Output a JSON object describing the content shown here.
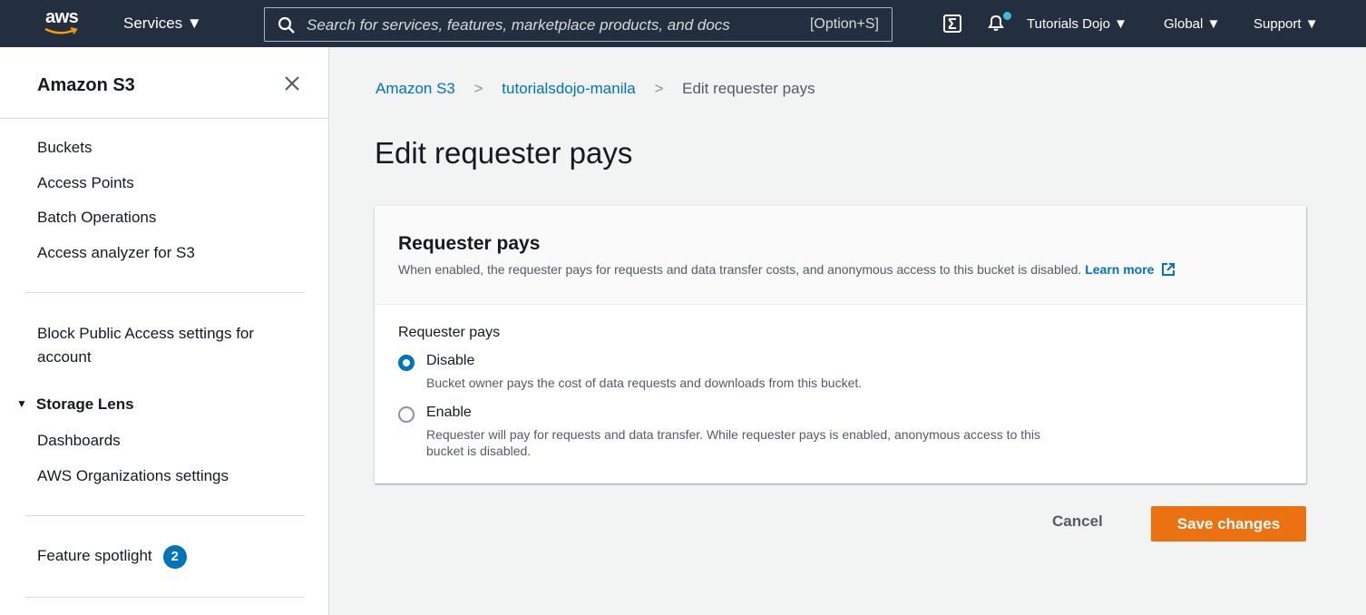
{
  "topnav": {
    "logo_text": "aws",
    "services_label": "Services ▼",
    "search_placeholder": "Search for services, features, marketplace products, and docs",
    "search_shortcut": "[Option+S]",
    "account_label": "Tutorials Dojo ▼",
    "region_label": "Global ▼",
    "support_label": "Support ▼",
    "notification_dot_color": "#44b9d6"
  },
  "sidebar": {
    "title": "Amazon S3",
    "items_group1": [
      "Buckets",
      "Access Points",
      "Batch Operations",
      "Access analyzer for S3"
    ],
    "block_public_access_line1": "Block Public Access settings for",
    "block_public_access_line2": "account",
    "storage_lens": {
      "label": "Storage Lens",
      "expanded": true,
      "items": [
        "Dashboards",
        "AWS Organizations settings"
      ]
    },
    "feature_spotlight": {
      "label": "Feature spotlight",
      "badge": "2"
    }
  },
  "breadcrumb": {
    "items": [
      "Amazon S3",
      "tutorialsdojo-manila",
      "Edit requester pays"
    ]
  },
  "page": {
    "title": "Edit requester pays"
  },
  "card": {
    "title": "Requester pays",
    "description": "When enabled, the requester pays for requests and data transfer costs, and anonymous access to this bucket is disabled.",
    "learn_more": "Learn more",
    "field_label": "Requester pays",
    "options": [
      {
        "label": "Disable",
        "description": "Bucket owner pays the cost of data requests and downloads from this bucket.",
        "selected": true
      },
      {
        "label": "Enable",
        "description": "Requester will pay for requests and data transfer. While requester pays is enabled, anonymous access to this bucket is disabled.",
        "selected": false
      }
    ]
  },
  "actions": {
    "cancel": "Cancel",
    "save": "Save changes"
  },
  "colors": {
    "topnav_bg": "#232f3e",
    "link": "#0073bb",
    "primary_button": "#ec7211"
  }
}
